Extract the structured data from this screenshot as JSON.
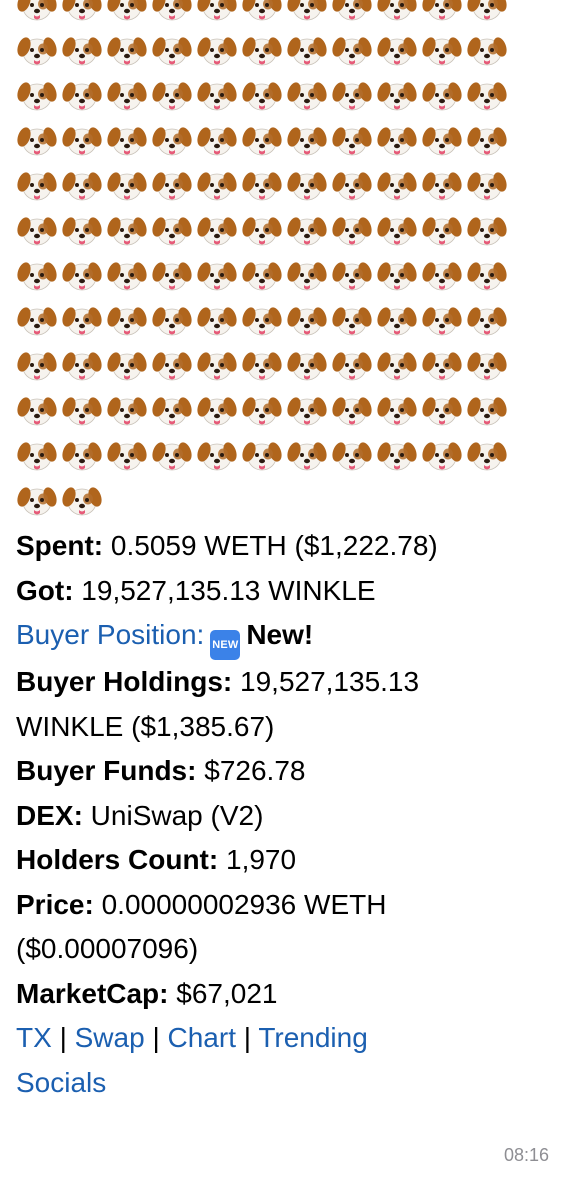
{
  "message": {
    "emoji_icon": "dog-face-icon",
    "emoji_count": 123,
    "spent": {
      "label": "Spent:",
      "value": " 0.5059 WETH ($1,222.78)"
    },
    "got": {
      "label": "Got:",
      "value": " 19,527,135.13 WINKLE"
    },
    "buyer_position": {
      "label": "Buyer Position:",
      "badge": "NEW",
      "value": "New!"
    },
    "buyer_holdings": {
      "label": "Buyer Holdings:",
      "value": " 19,527,135.13",
      "value2": "WINKLE ($1,385.67)"
    },
    "buyer_funds": {
      "label": "Buyer Funds:",
      "value": " $726.78"
    },
    "dex": {
      "label": "DEX:",
      "value": " UniSwap (V2)"
    },
    "holders_count": {
      "label": "Holders Count:",
      "value": " 1,970"
    },
    "price": {
      "label": "Price:",
      "value": " 0.00000002936 WETH",
      "value2": "($0.00007096)"
    },
    "marketcap": {
      "label": "MarketCap:",
      "value": " $67,021"
    },
    "links": {
      "tx": "TX",
      "swap": "Swap",
      "chart": "Chart",
      "trending": "Trending",
      "separator": "|",
      "socials": "Socials"
    },
    "time": "08:16"
  },
  "colors": {
    "link": "#1b5fb0",
    "timestamp": "#8e8e93",
    "badge": "#3b82e8"
  }
}
